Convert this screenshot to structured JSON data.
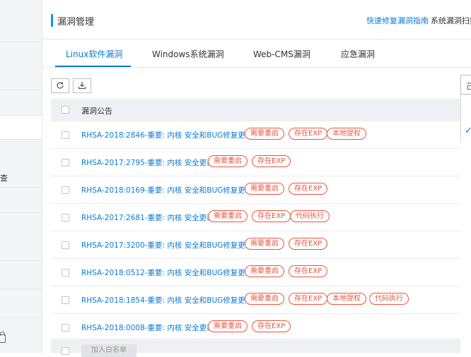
{
  "header": {
    "title": "漏洞管理",
    "guide_link": "快速修复漏洞指南",
    "scan_link": "系统漏洞扫描"
  },
  "sidebar": {
    "partial_label": "查",
    "icon": "lock-icon"
  },
  "tabs": [
    {
      "label": "Linux软件漏洞",
      "active": true
    },
    {
      "label": "Windows系统漏洞",
      "active": false
    },
    {
      "label": "Web-CMS漏洞",
      "active": false
    },
    {
      "label": "应急漏洞",
      "active": false
    }
  ],
  "toolbar": {
    "refresh_icon": "refresh-icon",
    "export_icon": "download-icon",
    "right_button_label": "己"
  },
  "table": {
    "column_header": "漏洞公告",
    "rows": [
      {
        "title": "RHSA-2018:2846-重要: 内核 安全和BUG修复更新",
        "tags": [
          "需要重启",
          "存在EXP",
          "本地提权"
        ]
      },
      {
        "title": "RHSA-2017:2795-重要: 内核 安全更新",
        "tags": [
          "需要重启",
          "存在EXP"
        ]
      },
      {
        "title": "RHSA-2018:0169-重要: 内核 安全和BUG修复更新",
        "tags": [
          "需要重启",
          "存在EXP"
        ]
      },
      {
        "title": "RHSA-2017:2681-重要: 内核 安全更新",
        "tags": [
          "需要重启",
          "存在EXP",
          "代码执行"
        ]
      },
      {
        "title": "RHSA-2017:3200-重要: 内核 安全和BUG修复更新",
        "tags": [
          "需要重启",
          "存在EXP"
        ]
      },
      {
        "title": "RHSA-2018:0512-重要: 内核 安全和BUG修复更新",
        "tags": [
          "需要重启",
          "存在EXP"
        ]
      },
      {
        "title": "RHSA-2018:1854-重要: 内核 安全和BUG修复更新",
        "tags": [
          "需要重启",
          "存在EXP",
          "本地提权",
          "代码执行"
        ]
      },
      {
        "title": "RHSA-2018:0008-重要: 内核 安全更新",
        "tags": [
          "需要重启",
          "存在EXP"
        ]
      }
    ],
    "footer_button": "加入白名单"
  },
  "colors": {
    "accent": "#0a7ad8",
    "tag": "#e8563f",
    "header_bg": "#eef0f3"
  }
}
